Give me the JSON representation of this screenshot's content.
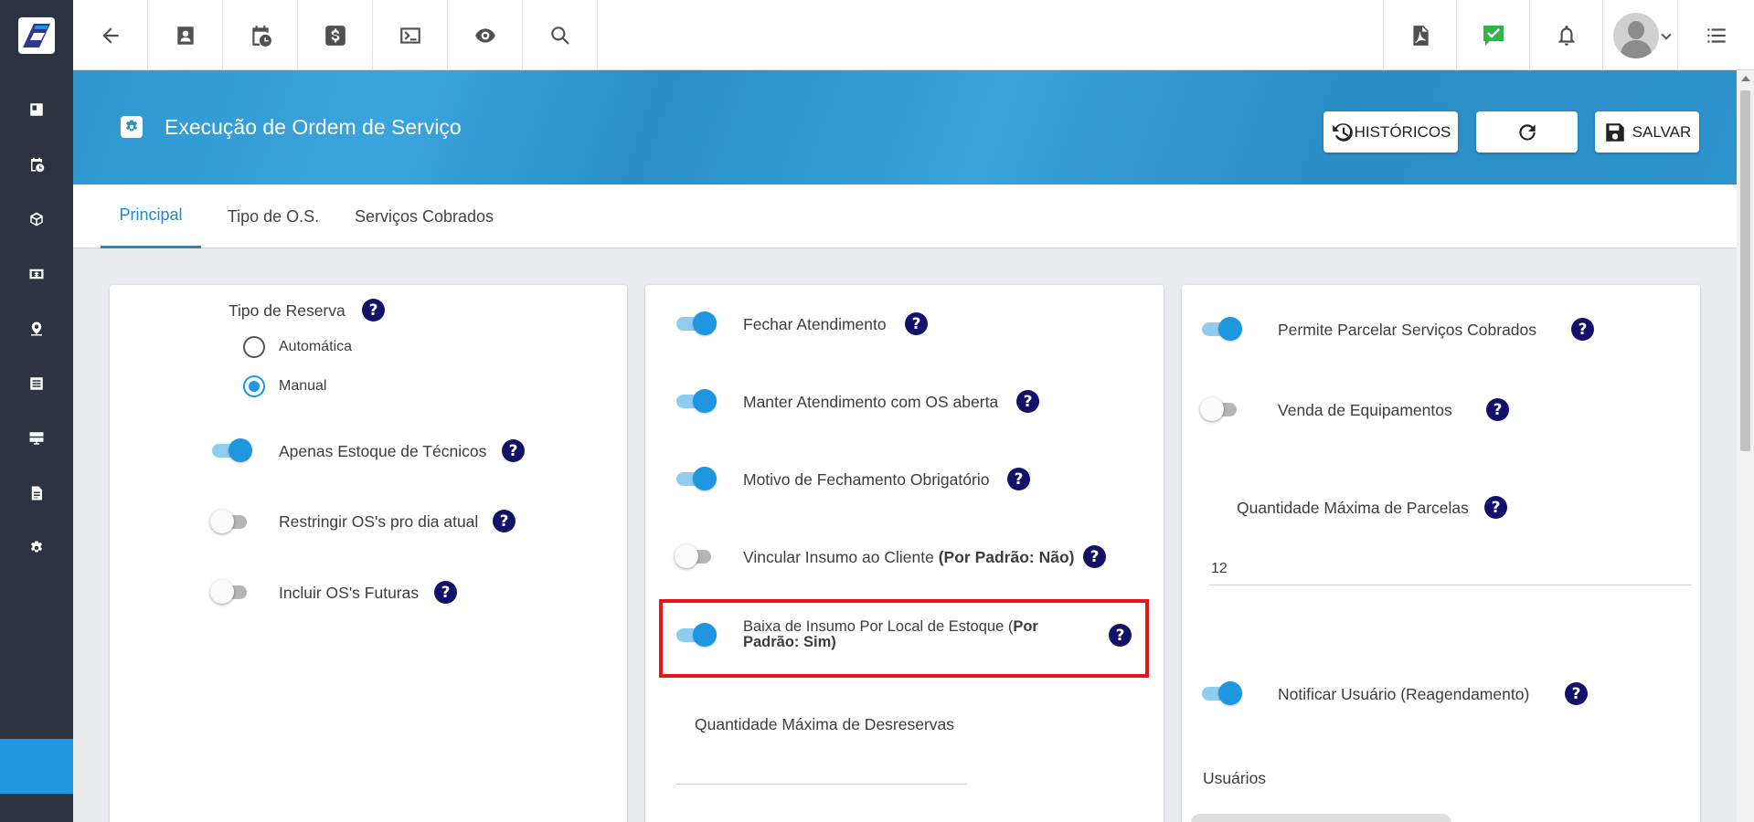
{
  "header": {
    "title": "Execução de Ordem de Serviço",
    "historicos_label": "HISTÓRICOS",
    "salvar_label": "SALVAR"
  },
  "topbar": {
    "left_icons": [
      "arrow-left-icon",
      "contact-card-icon",
      "calendar-clock-icon",
      "dollar-icon",
      "terminal-icon",
      "eye-icon",
      "search-icon"
    ],
    "right_icons": [
      "pdf-icon",
      "check-message-icon",
      "bell-icon",
      "avatar",
      "list-icon"
    ]
  },
  "sidebar": {
    "items": [
      "dashboard-icon",
      "calendar-clock-icon",
      "box-icon",
      "money-icon",
      "map-pin-icon",
      "list-box-icon",
      "server-icon",
      "document-icon",
      "gear-icon"
    ]
  },
  "tabs": [
    {
      "label": "Principal",
      "active": true
    },
    {
      "label": "Tipo de O.S.",
      "active": false
    },
    {
      "label": "Serviços Cobrados",
      "active": false
    }
  ],
  "col1": {
    "tipo_reserva_label": "Tipo de Reserva",
    "radio_options": [
      {
        "label": "Automática",
        "selected": false
      },
      {
        "label": "Manual",
        "selected": true
      }
    ],
    "toggles": [
      {
        "label": "Apenas Estoque de Técnicos",
        "on": true
      },
      {
        "label": "Restringir OS's pro dia atual",
        "on": false
      },
      {
        "label": "Incluir OS's Futuras",
        "on": false
      }
    ]
  },
  "col2": {
    "toggles": [
      {
        "label": "Fechar Atendimento",
        "on": true
      },
      {
        "label": "Manter Atendimento com OS aberta",
        "on": true
      },
      {
        "label": "Motivo de Fechamento Obrigatório",
        "on": true
      },
      {
        "label": "Vincular Insumo ao Cliente",
        "bold": "(Por Padrão: Não)",
        "on": false
      },
      {
        "label": "Baixa de Insumo Por Local de Estoque (",
        "bold": "Por",
        "line2": "Padrão: Sim)",
        "on": true
      }
    ],
    "qtd_desreservas_label": "Quantidade Máxima de Desreservas",
    "qtd_desreservas_value": ""
  },
  "col3": {
    "toggles": [
      {
        "label": "Permite Parcelar Serviços Cobrados",
        "on": true
      },
      {
        "label": "Venda de Equipamentos",
        "on": false
      }
    ],
    "qtd_parcelas_label": "Quantidade Máxima de Parcelas",
    "qtd_parcelas_value": "12",
    "notificar_label": "Notificar Usuário (Reagendamento)",
    "notificar_on": true,
    "usuarios_label": "Usuários"
  },
  "colors": {
    "accent": "#1e96e0",
    "sidebar": "#2b3240",
    "highlight": "#e8141b",
    "help": "#12126a"
  }
}
